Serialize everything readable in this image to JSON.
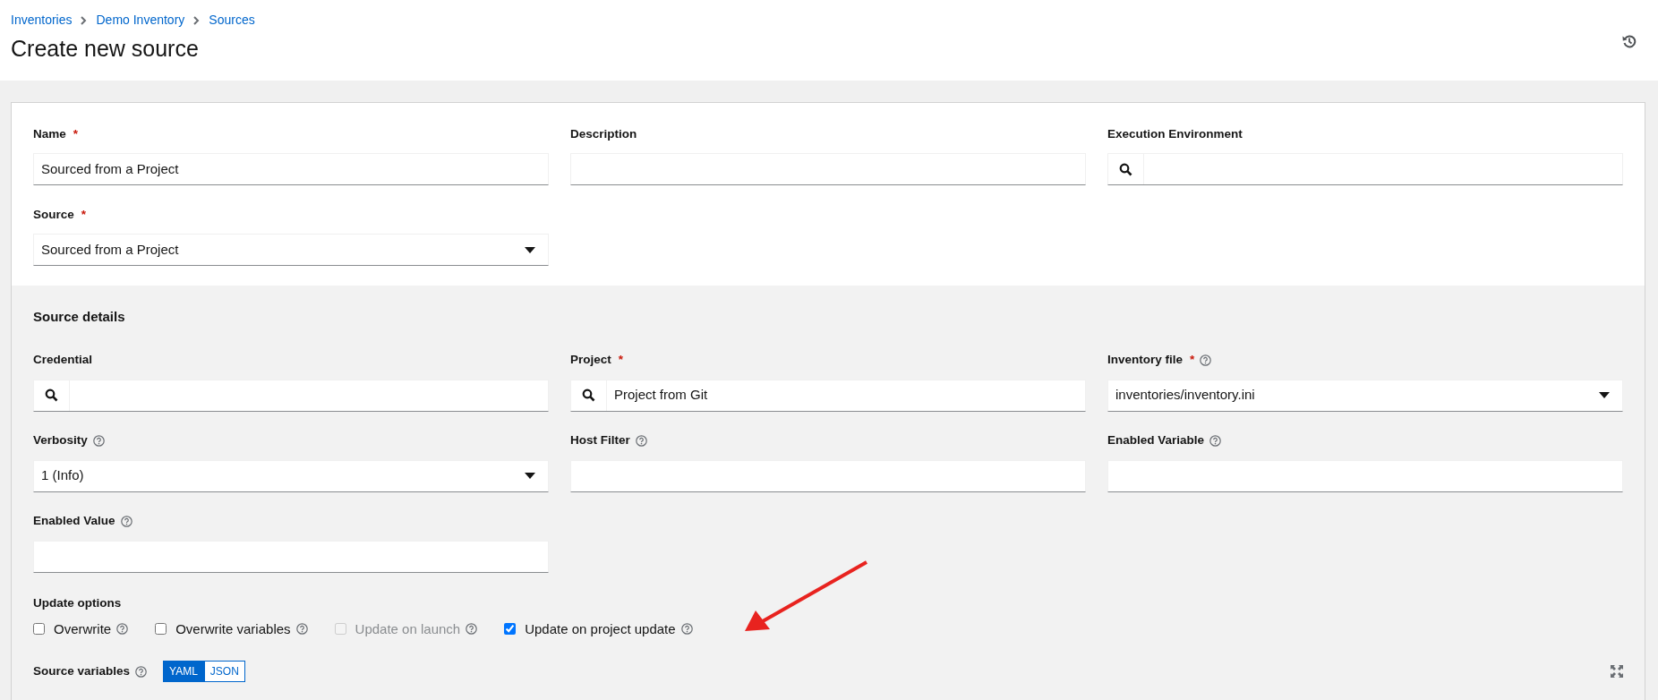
{
  "breadcrumb": [
    {
      "label": "Inventories"
    },
    {
      "label": "Demo Inventory"
    },
    {
      "label": "Sources"
    }
  ],
  "title": "Create new source",
  "main_fields": [
    {
      "kind": "text",
      "label": "Name",
      "required_mark": "*",
      "value": "Sourced from a Project"
    },
    {
      "kind": "text",
      "label": "Description"
    },
    {
      "kind": "lookup",
      "label": "Execution Environment"
    },
    {
      "kind": "select",
      "label": "Source",
      "required_mark": "*",
      "value": "Sourced from a Project"
    }
  ],
  "source_details": {
    "heading": "Source details",
    "fields": [
      {
        "kind": "lookup",
        "label": "Credential",
        "help": false
      },
      {
        "kind": "lookup",
        "label": "Project",
        "required_mark": "*",
        "help": false,
        "value": "Project from Git"
      },
      {
        "kind": "select",
        "label": "Inventory file",
        "required_mark": "*",
        "help": true,
        "value": "inventories/inventory.ini"
      },
      {
        "kind": "select",
        "label": "Verbosity",
        "help": true,
        "value": "1 (Info)"
      },
      {
        "kind": "text",
        "label": "Host Filter",
        "help": true
      },
      {
        "kind": "text",
        "label": "Enabled Variable",
        "help": true
      },
      {
        "kind": "text",
        "label": "Enabled Value",
        "help": true
      }
    ],
    "update_options": {
      "label": "Update options",
      "options": [
        {
          "label": "Overwrite",
          "checked": false,
          "disabled": false
        },
        {
          "label": "Overwrite variables",
          "checked": false,
          "disabled": false
        },
        {
          "label": "Update on launch",
          "checked": false,
          "disabled": true
        },
        {
          "label": "Update on project update",
          "checked": true,
          "disabled": false
        }
      ]
    },
    "source_variables": {
      "label": "Source variables",
      "modes": [
        {
          "label": "YAML",
          "selected": true
        },
        {
          "label": "JSON",
          "selected": false
        }
      ]
    }
  }
}
